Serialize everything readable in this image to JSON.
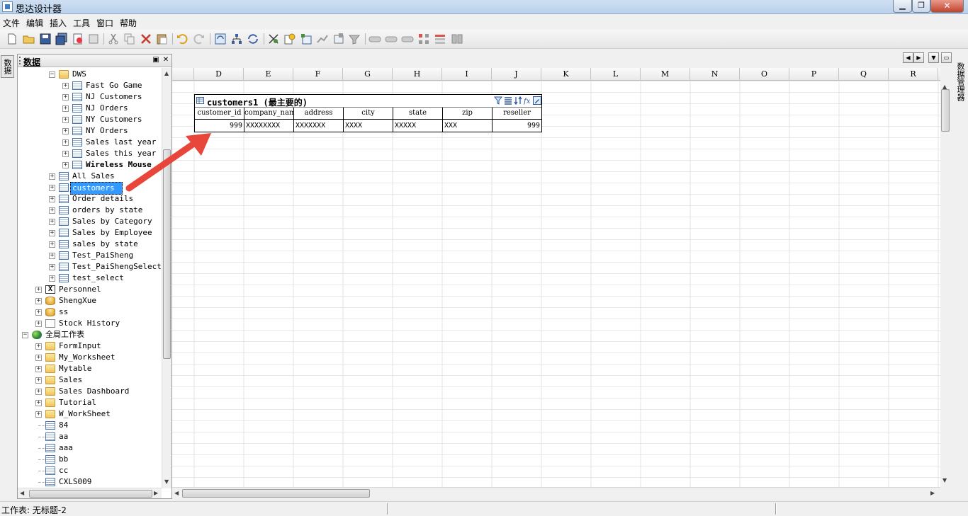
{
  "window": {
    "title": "思达设计器"
  },
  "menu": [
    "文件",
    "编辑",
    "插入",
    "工具",
    "窗口",
    "帮助"
  ],
  "side_tab": "数据",
  "right_tab": "数据管理器",
  "panel": {
    "title": "数据"
  },
  "tree": [
    {
      "label": "DWS",
      "indent": 2,
      "icon": "folder",
      "expander": "-"
    },
    {
      "label": "Fast Go Game",
      "indent": 3,
      "icon": "table",
      "expander": "+"
    },
    {
      "label": "NJ Customers",
      "indent": 3,
      "icon": "table",
      "expander": "+"
    },
    {
      "label": "NJ Orders",
      "indent": 3,
      "icon": "table",
      "expander": "+"
    },
    {
      "label": "NY Customers",
      "indent": 3,
      "icon": "table",
      "expander": "+"
    },
    {
      "label": "NY Orders",
      "indent": 3,
      "icon": "table",
      "expander": "+"
    },
    {
      "label": "Sales last year",
      "indent": 3,
      "icon": "table",
      "expander": "+"
    },
    {
      "label": "Sales this year",
      "indent": 3,
      "icon": "table",
      "expander": "+"
    },
    {
      "label": "Wireless Mouse",
      "indent": 3,
      "icon": "table",
      "expander": "+",
      "bold": true
    },
    {
      "label": "All Sales",
      "indent": 2,
      "icon": "table",
      "expander": "+"
    },
    {
      "label": "customers",
      "indent": 2,
      "icon": "table",
      "expander": "+",
      "selected": true
    },
    {
      "label": "Order details",
      "indent": 2,
      "icon": "table",
      "expander": "+"
    },
    {
      "label": "orders by state",
      "indent": 2,
      "icon": "table",
      "expander": "+"
    },
    {
      "label": "Sales by Category",
      "indent": 2,
      "icon": "table",
      "expander": "+"
    },
    {
      "label": "Sales by Employee",
      "indent": 2,
      "icon": "table",
      "expander": "+"
    },
    {
      "label": "sales by state",
      "indent": 2,
      "icon": "table",
      "expander": "+"
    },
    {
      "label": "Test_PaiSheng",
      "indent": 2,
      "icon": "table",
      "expander": "+"
    },
    {
      "label": "Test_PaiShengSelect",
      "indent": 2,
      "icon": "table",
      "expander": "+"
    },
    {
      "label": "test_select",
      "indent": 2,
      "icon": "table",
      "expander": "+"
    },
    {
      "label": "Personnel",
      "indent": 1,
      "icon": "xls",
      "expander": "+"
    },
    {
      "label": "ShengXue",
      "indent": 1,
      "icon": "db",
      "expander": "+"
    },
    {
      "label": "ss",
      "indent": 1,
      "icon": "db",
      "expander": "+"
    },
    {
      "label": "Stock History",
      "indent": 1,
      "icon": "doc",
      "expander": "+"
    },
    {
      "label": "全局工作表",
      "indent": 0,
      "icon": "globe",
      "expander": "-",
      "cjk": true
    },
    {
      "label": "FormInput",
      "indent": 1,
      "icon": "folder",
      "expander": "+"
    },
    {
      "label": "My_Worksheet",
      "indent": 1,
      "icon": "folder",
      "expander": "+"
    },
    {
      "label": "Mytable",
      "indent": 1,
      "icon": "folder",
      "expander": "+"
    },
    {
      "label": "Sales",
      "indent": 1,
      "icon": "folder",
      "expander": "+"
    },
    {
      "label": "Sales Dashboard",
      "indent": 1,
      "icon": "folder",
      "expander": "+"
    },
    {
      "label": "Tutorial",
      "indent": 1,
      "icon": "folder",
      "expander": "+"
    },
    {
      "label": "W_WorkSheet",
      "indent": 1,
      "icon": "folder",
      "expander": "+"
    },
    {
      "label": "84",
      "indent": 1,
      "icon": "leaf",
      "expander": ""
    },
    {
      "label": "aa",
      "indent": 1,
      "icon": "leaf",
      "expander": ""
    },
    {
      "label": "aaa",
      "indent": 1,
      "icon": "leaf",
      "expander": ""
    },
    {
      "label": "bb",
      "indent": 1,
      "icon": "leaf",
      "expander": ""
    },
    {
      "label": "cc",
      "indent": 1,
      "icon": "leaf",
      "expander": ""
    },
    {
      "label": "CXLS009",
      "indent": 1,
      "icon": "leaf",
      "expander": ""
    }
  ],
  "sheet": {
    "columns": [
      "D",
      "E",
      "F",
      "G",
      "H",
      "I",
      "J",
      "K",
      "L",
      "M",
      "N",
      "O",
      "P",
      "Q",
      "R"
    ]
  },
  "widget": {
    "title": "customers1 (最主要的)",
    "headers": [
      "customer_id",
      "company_name",
      "address",
      "city",
      "state",
      "zip",
      "reseller"
    ],
    "row": [
      "999",
      "XXXXXXXX",
      "XXXXXXX",
      "XXXX",
      "XXXXX",
      "XXX",
      "999"
    ],
    "align": [
      "right",
      "left",
      "left",
      "left",
      "left",
      "left",
      "right"
    ]
  },
  "status": {
    "text": "工作表: 无标题-2"
  },
  "colors": {
    "selection": "#3399ff",
    "arrow": "#e8463a",
    "titlebar": "#b9d1ea"
  }
}
